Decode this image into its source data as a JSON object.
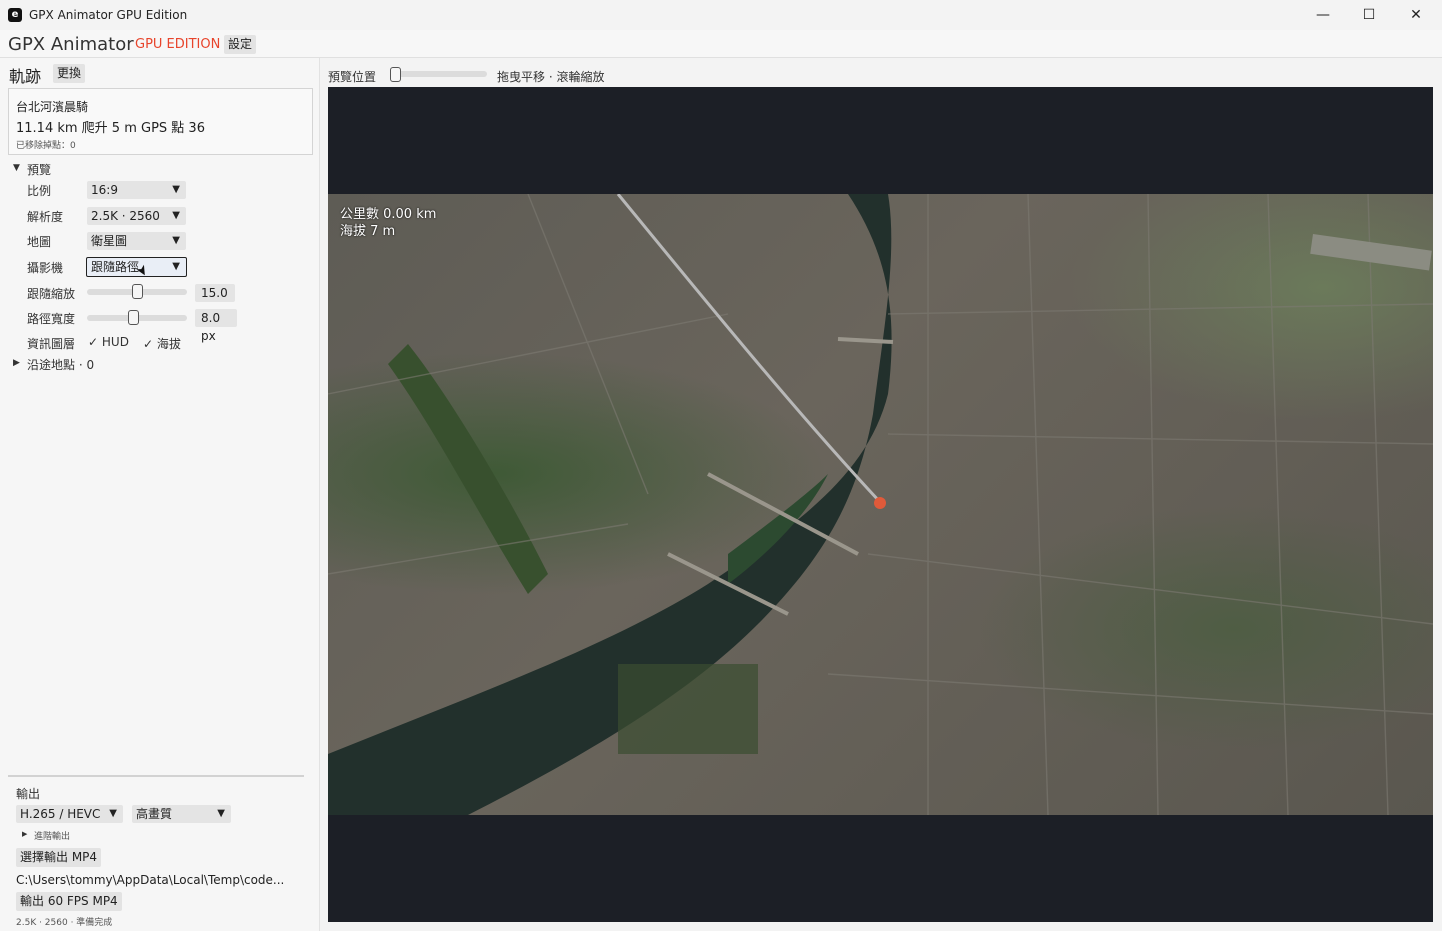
{
  "window": {
    "title": "GPX Animator GPU Edition",
    "icon_glyph": "e",
    "controls": {
      "minimize": "—",
      "maximize": "☐",
      "close": "✕"
    }
  },
  "menubar": {
    "brand": "GPX Animator",
    "edition": "GPU EDITION",
    "settings_label": "設定",
    "edition_color": "#e8452c"
  },
  "track": {
    "section_title": "軌跡",
    "replace_label": "更換",
    "name": "台北河濱晨騎",
    "stats": "11.14 km  爬升 5 m  GPS 點 36",
    "removed": "已移除掉點：0"
  },
  "preview_section": {
    "title": "預覽",
    "rows": {
      "ratio": {
        "label": "比例",
        "value": "16:9"
      },
      "resolution": {
        "label": "解析度",
        "value": "2.5K · 2560"
      },
      "map": {
        "label": "地圖",
        "value": "衛星圖"
      },
      "camera": {
        "label": "攝影機",
        "value": "跟隨路徑"
      },
      "follow_zoom": {
        "label": "跟隨縮放",
        "value": "15.0",
        "fraction": 0.5
      },
      "path_width": {
        "label": "路徑寬度",
        "value": "8.0 px",
        "fraction": 0.46
      },
      "overlays": {
        "label": "資訊圖層",
        "hud": "HUD",
        "elevation": "海拔",
        "check": "✓"
      }
    }
  },
  "waypoints": {
    "label": "沿途地點 · 0"
  },
  "output": {
    "title": "輸出",
    "codec": "H.265 / HEVC",
    "quality": "高畫質",
    "advanced": "進階輸出",
    "choose_label": "選擇輸出 MP4",
    "path": "C:\\Users\\tommy\\AppData\\Local\\Temp\\code...",
    "export_label": "輸出 60 FPS MP4",
    "status": "2.5K · 2560 · 準備完成"
  },
  "preview_area": {
    "position_label": "預覽位置",
    "position_fraction": 0.0,
    "hint": "拖曳平移 · 滾輪縮放",
    "hud_distance": "公里數 0.00 km",
    "hud_elevation": "海拔 7 m",
    "background_color": "#1c1f26",
    "route_color": "#e05a3a"
  },
  "icons": {
    "triangle_down": "▼",
    "triangle_right": "▶",
    "combo_arrow": "▼",
    "cursor": "➤"
  }
}
